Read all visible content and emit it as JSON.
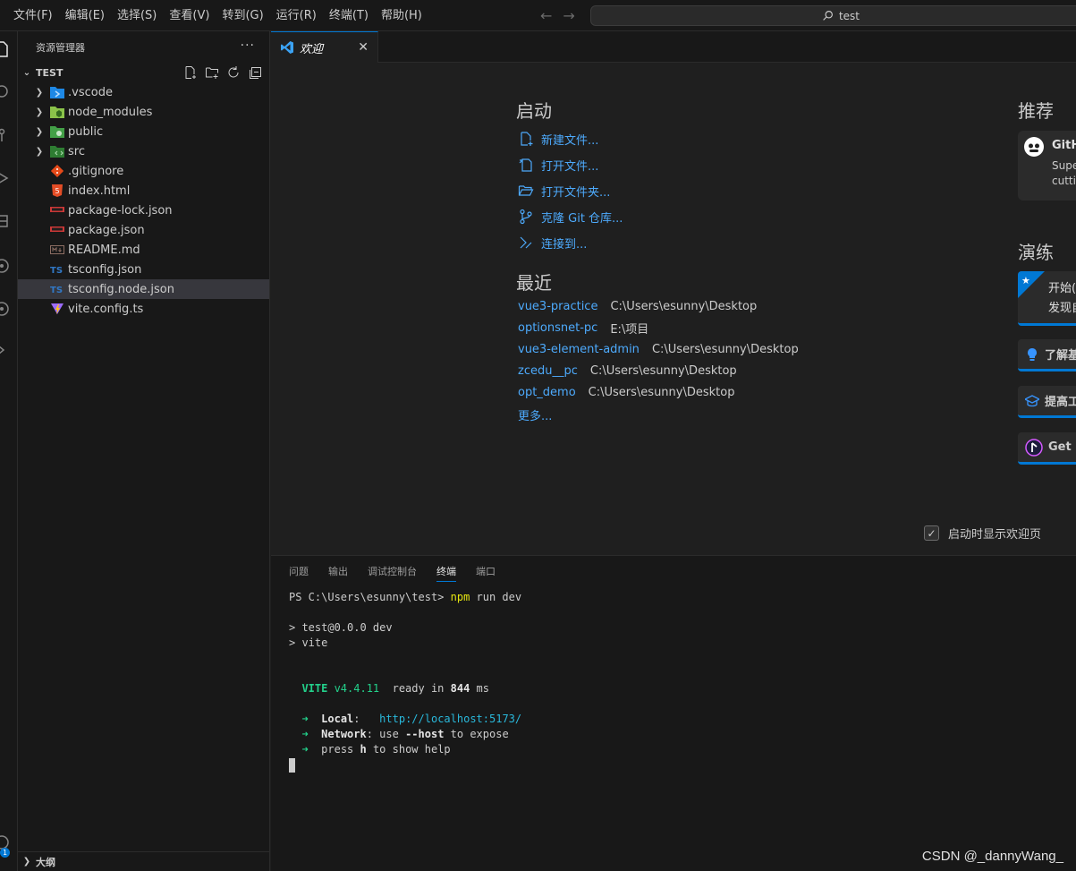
{
  "menu": [
    "文件(F)",
    "编辑(E)",
    "选择(S)",
    "查看(V)",
    "转到(G)",
    "运行(R)",
    "终端(T)",
    "帮助(H)"
  ],
  "command_center": {
    "text": "test"
  },
  "account": {
    "badge": "1"
  },
  "sidebar": {
    "title": "资源管理器",
    "more": "···",
    "folder": "TEST",
    "items": [
      {
        "name": ".vscode",
        "type": "folder",
        "icon": "vscode-folder-icon"
      },
      {
        "name": "node_modules",
        "type": "folder",
        "icon": "node-folder-icon"
      },
      {
        "name": "public",
        "type": "folder",
        "icon": "public-folder-icon"
      },
      {
        "name": "src",
        "type": "folder",
        "icon": "src-folder-icon"
      },
      {
        "name": ".gitignore",
        "type": "file",
        "icon": "git-icon"
      },
      {
        "name": "index.html",
        "type": "file",
        "icon": "html-icon"
      },
      {
        "name": "package-lock.json",
        "type": "file",
        "icon": "npm-icon"
      },
      {
        "name": "package.json",
        "type": "file",
        "icon": "npm-icon"
      },
      {
        "name": "README.md",
        "type": "file",
        "icon": "markdown-icon"
      },
      {
        "name": "tsconfig.json",
        "type": "file",
        "icon": "ts-icon"
      },
      {
        "name": "tsconfig.node.json",
        "type": "file",
        "icon": "ts-icon",
        "selected": true
      },
      {
        "name": "vite.config.ts",
        "type": "file",
        "icon": "vite-icon"
      }
    ],
    "outline": "大纲"
  },
  "tab": {
    "label": "欢迎",
    "close": "✕"
  },
  "welcome": {
    "start": {
      "title": "启动",
      "items": [
        "新建文件...",
        "打开文件...",
        "打开文件夹...",
        "克隆 Git 仓库...",
        "连接到..."
      ]
    },
    "recent": {
      "title": "最近",
      "items": [
        {
          "name": "vue3-practice",
          "path": "C:\\Users\\esunny\\Desktop"
        },
        {
          "name": "optionsnet-pc",
          "path": "E:\\项目"
        },
        {
          "name": "vue3-element-admin",
          "path": "C:\\Users\\esunny\\Desktop"
        },
        {
          "name": "zcedu__pc",
          "path": "C:\\Users\\esunny\\Desktop"
        },
        {
          "name": "opt_demo",
          "path": "C:\\Users\\esunny\\Desktop"
        }
      ],
      "more": "更多..."
    },
    "recommended": {
      "title": "推荐",
      "card": {
        "title": "GitH",
        "line1": "Supe",
        "line2": "cuttin"
      }
    },
    "walkthroughs": {
      "title": "演练",
      "featured": {
        "line1": "开始(",
        "line2": "发现自"
      },
      "items": [
        "了解基",
        "提高工",
        "Get S"
      ]
    },
    "show_on_startup": "启动时显示欢迎页"
  },
  "panel": {
    "tabs": [
      "问题",
      "输出",
      "调试控制台",
      "终端",
      "端口"
    ],
    "active_tab": "终端"
  },
  "terminal": {
    "prompt": "PS C:\\Users\\esunny\\test> ",
    "cmd": "npm",
    "cmd_args": " run dev",
    "line_pkg": "> test@0.0.0 dev",
    "line_vite": "> vite",
    "vite_label": "VITE",
    "vite_version": " v4.4.11",
    "ready_text": "  ready in ",
    "ready_ms": "844",
    "ready_unit": " ms",
    "arrow": "➜",
    "local_label": "Local",
    "local_url": "http://localhost:5173/",
    "network_label": "Network",
    "network_text": ": use ",
    "network_host": "--host",
    "network_end": " to expose",
    "help_pre": "press ",
    "help_key": "h",
    "help_end": " to show help"
  },
  "watermark": "CSDN @_dannyWang_"
}
